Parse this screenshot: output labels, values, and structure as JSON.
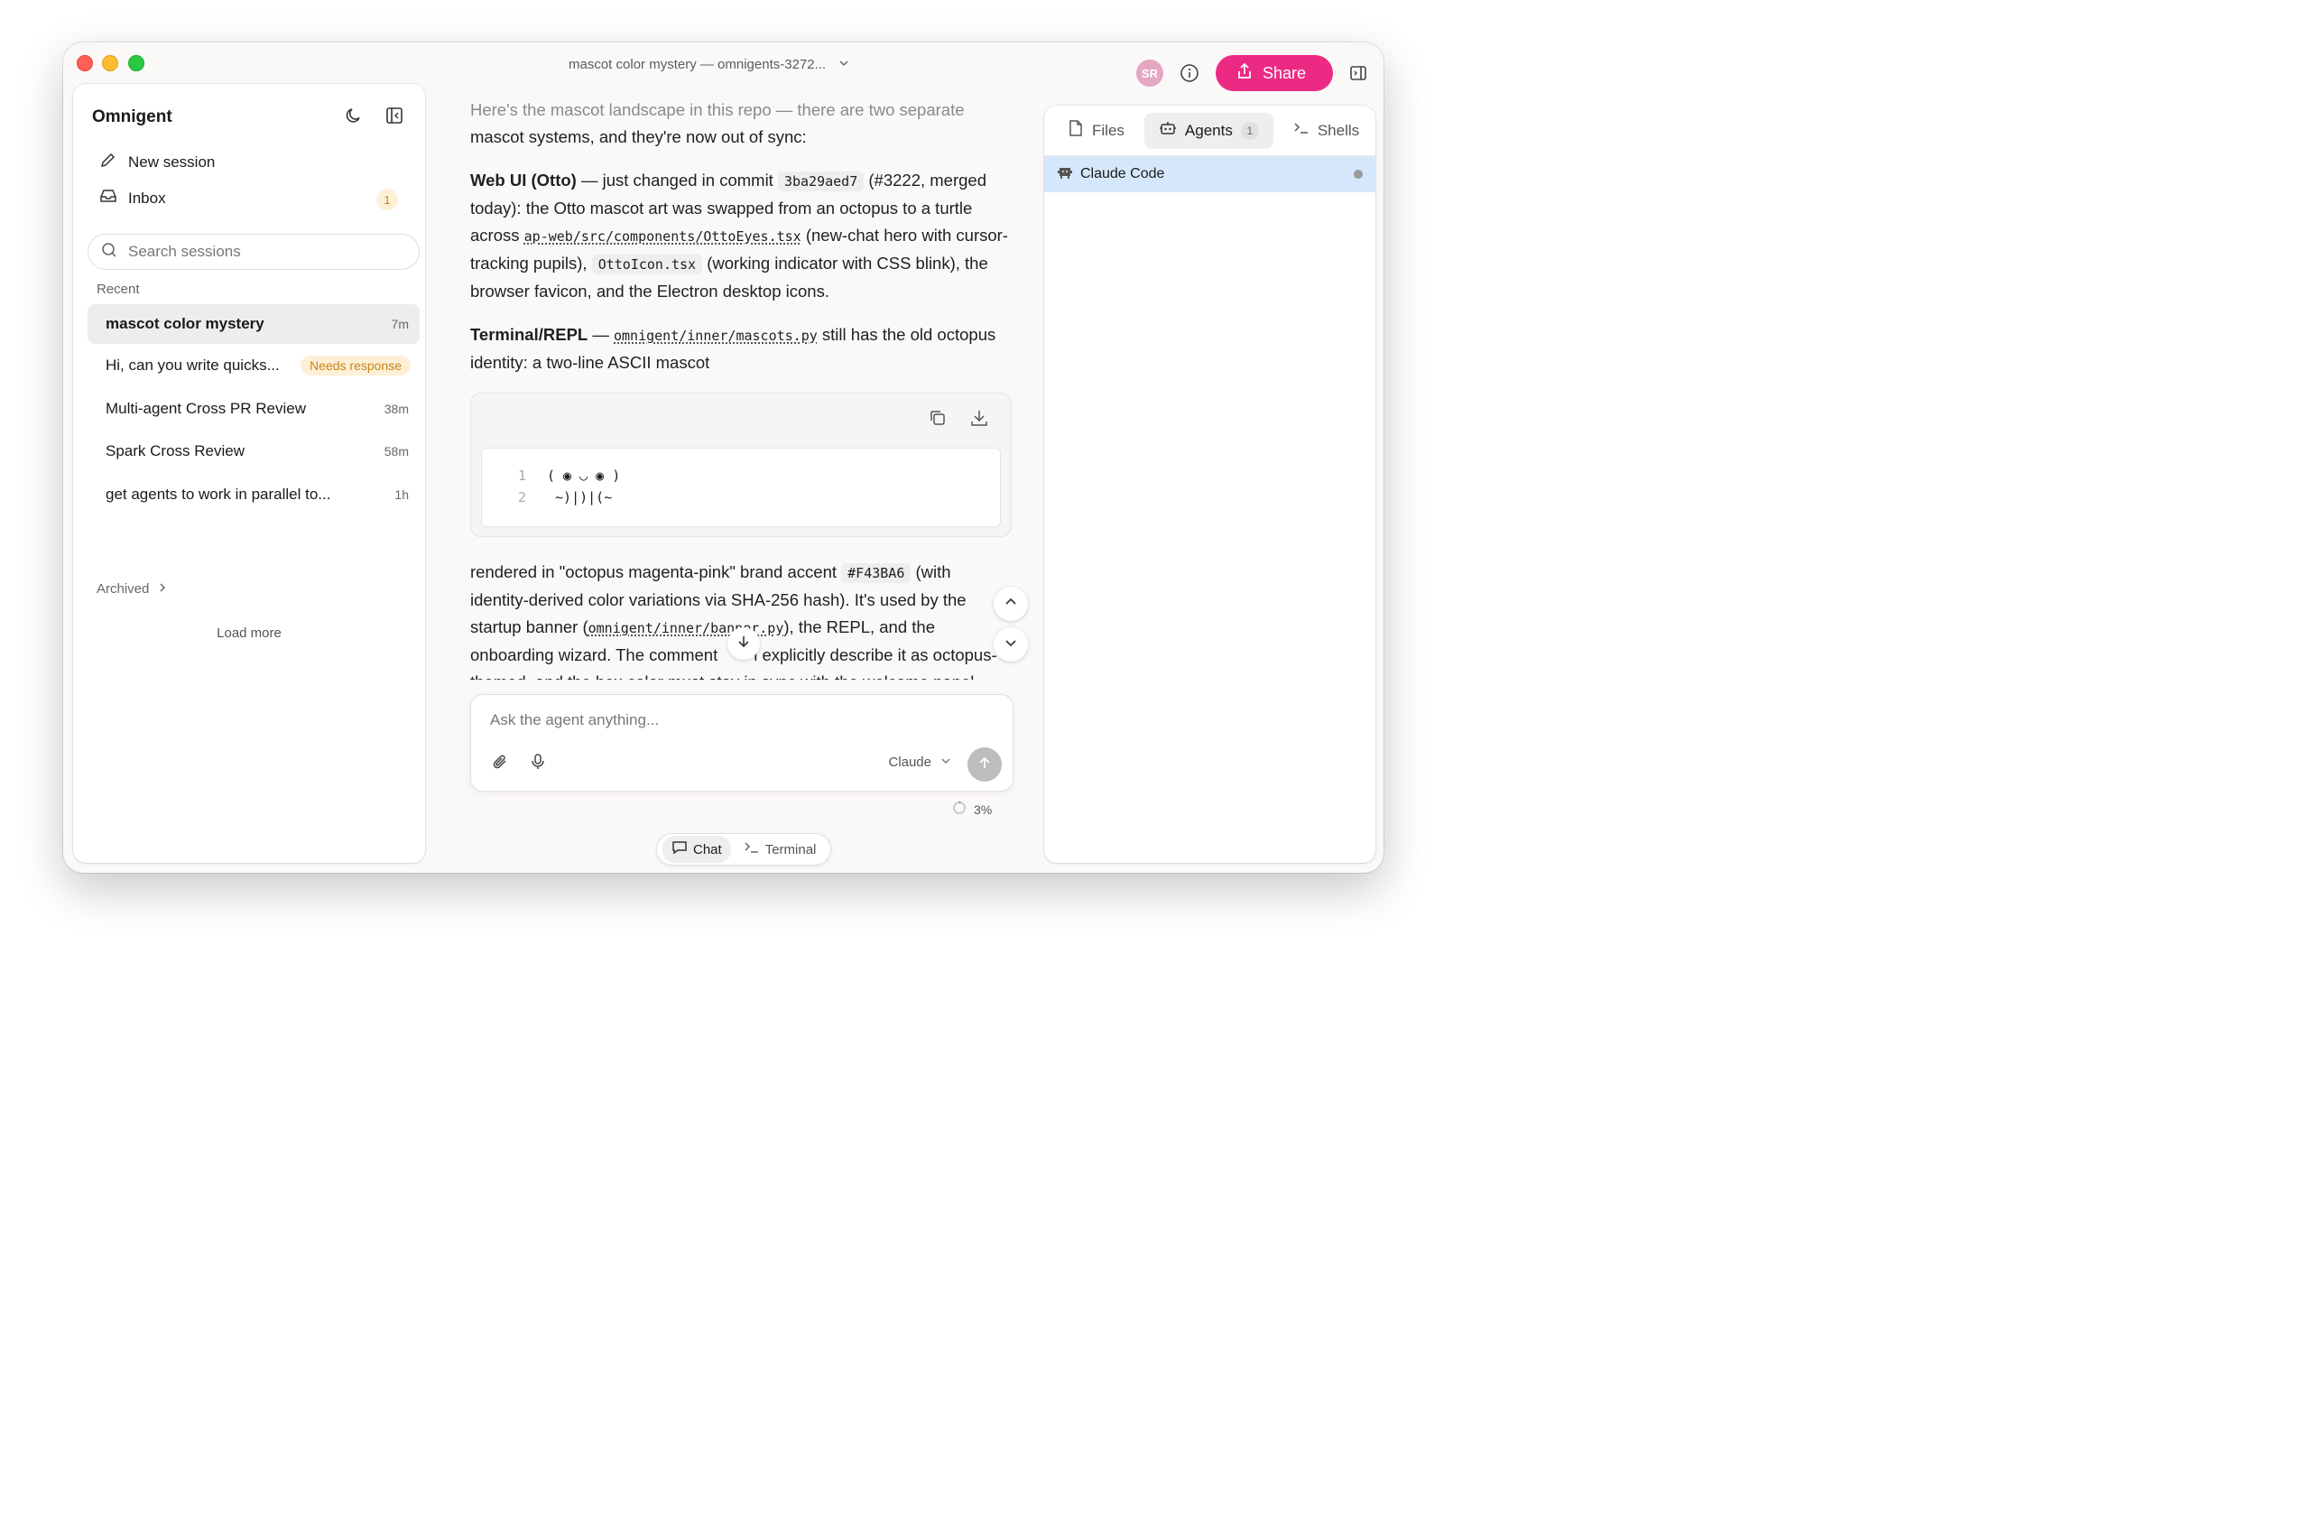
{
  "window": {
    "title": "mascot color mystery — omnigents-3272...",
    "avatar_initials": "SR",
    "share_label": "Share",
    "accent_color": "#EC2A84"
  },
  "sidebar": {
    "brand": "Omnigent",
    "new_session_label": "New session",
    "inbox_label": "Inbox",
    "inbox_count": "1",
    "search_placeholder": "Search sessions",
    "recent_label": "Recent",
    "sessions": [
      {
        "title": "mascot color mystery",
        "time": "7m"
      },
      {
        "title": "Hi, can you write quicks...",
        "badge": "Needs response"
      },
      {
        "title": "Multi-agent Cross PR Review",
        "time": "38m"
      },
      {
        "title": "Spark Cross Review",
        "time": "58m"
      },
      {
        "title": "get agents to work in parallel to...",
        "time": "1h"
      }
    ],
    "archived_label": "Archived",
    "load_more_label": "Load more"
  },
  "chat": {
    "intro_a": "Here's the mascot landscape in this repo — there are two separate",
    "intro_b": "mascot systems, and they're now out of sync:",
    "p1_bold": "Web UI (Otto)",
    "p1_t1": " — just changed in commit ",
    "p1_commit": "3ba29aed7",
    "p1_t2": " (#3222, merged today): the Otto mascot art was swapped from an octopus to a turtle across ",
    "p1_path": "ap-web/src/components/OttoEyes.tsx",
    "p1_t3": " (new-chat hero with cursor-tracking pupils), ",
    "p1_file": "OttoIcon.tsx",
    "p1_t4": " (working indicator with CSS blink), the browser favicon, and the Electron desktop icons.",
    "p2_bold": "Terminal/REPL",
    "p2_t1": " — ",
    "p2_path": "omnigent/inner/mascots.py",
    "p2_t2": " still has the old octopus identity: a two-line ASCII mascot",
    "code_lines": [
      {
        "n": "1",
        "text": "( ◉ ◡ ◉ )"
      },
      {
        "n": "2",
        "text": " ~)|)|(~"
      }
    ],
    "p3_t1": "rendered in \"octopus magenta-pink\" brand accent ",
    "p3_hex": "#F43BA6",
    "p3_t2": " (with identity-derived color variations via SHA-256 hash). It's used by the startup banner (",
    "p3_path": "omnigent/inner/banner.py",
    "p3_t3": "), the REPL, and the onboarding wizard. The comment",
    "p3_t4": "l explicitly describe it as octopus-themed, and the hex color must stay in sync with the welcome panel"
  },
  "composer": {
    "placeholder": "Ask the agent anything...",
    "model_label": "Claude",
    "context_usage": "3%"
  },
  "mode_toggle": {
    "chat_label": "Chat",
    "terminal_label": "Terminal"
  },
  "right_panel": {
    "tabs": [
      {
        "label": "Files"
      },
      {
        "label": "Agents",
        "count": "1"
      },
      {
        "label": "Shells"
      }
    ],
    "agents": [
      {
        "name": "Claude Code"
      }
    ]
  }
}
